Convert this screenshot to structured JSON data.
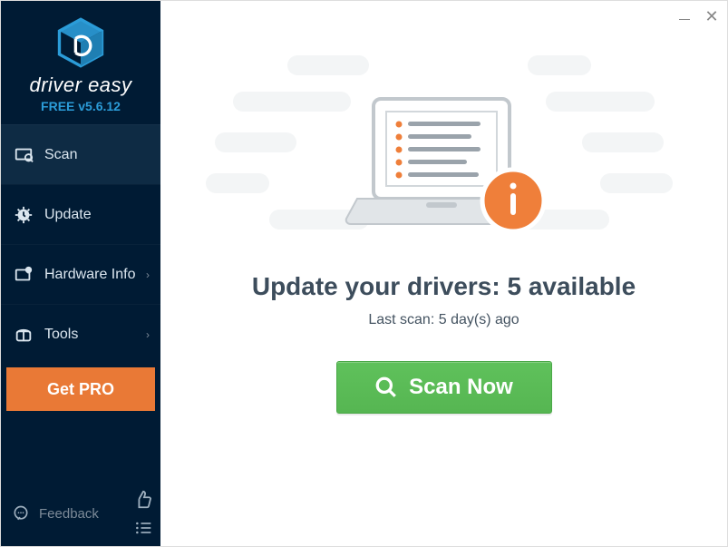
{
  "brand": {
    "name": "driver easy",
    "version": "FREE v5.6.12"
  },
  "sidebar": {
    "items": [
      {
        "label": "Scan"
      },
      {
        "label": "Update"
      },
      {
        "label": "Hardware Info"
      },
      {
        "label": "Tools"
      }
    ],
    "get_pro_label": "Get PRO",
    "feedback_label": "Feedback"
  },
  "main": {
    "headline_prefix": "Update your drivers: ",
    "available_count": 5,
    "headline_suffix": " available",
    "last_scan_prefix": "Last scan: ",
    "last_scan_value": "5 day(s) ago",
    "scan_button_label": "Scan Now"
  },
  "colors": {
    "sidebar_bg": "#001b34",
    "accent_orange": "#e97936",
    "logo_teal": "#2b9cd8",
    "scan_green": "#56b652",
    "info_orange": "#ef7f3a",
    "text_dark": "#3d4d5c"
  }
}
